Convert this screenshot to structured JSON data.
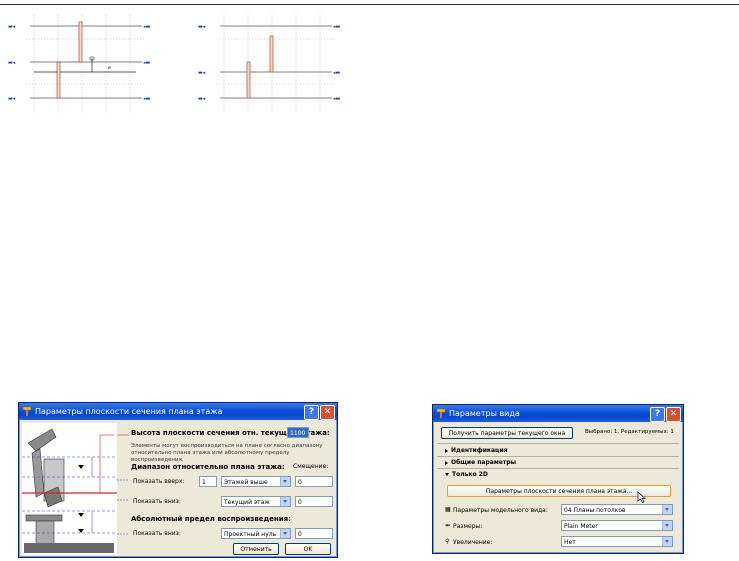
{
  "dialog_section": {
    "title": "Параметры плоскости сечения плана этажа",
    "height_label": "Высота плоскости сечения отн. текущего этажа:",
    "height_value": "1100",
    "description": "Элементы могут воспроизводиться на плане согласно диапазону относительно плана этажа или абсолютному пределу воспроизведения.",
    "range_heading": "Диапазон относительно плана этажа:",
    "offset_heading": "Смещение:",
    "show_up_label": "Показать вверх:",
    "show_up_count": "1",
    "show_up_select": "Этажей выше",
    "show_up_offset": "0",
    "show_down_label": "Показать вниз:",
    "show_down_select": "Текущий этаж",
    "show_down_offset": "0",
    "absolute_heading": "Абсолютный предел воспроизведения:",
    "abs_down_label": "Показать вниз:",
    "abs_down_select": "Проектный нуль",
    "abs_down_offset": "0",
    "cancel_label": "Отменить",
    "ok_label": "OK"
  },
  "dialog_view": {
    "title": "Параметры вида",
    "get_params_button": "Получить параметры текущего окна",
    "selected_info": "Выбрано: 1, Редактируемых: 1",
    "section_ident": "Идентификация",
    "section_general": "Общие параметры",
    "section_2d": "Только 2D",
    "cut_plane_button": "Параметры плоскости сечения плана этажа...",
    "model_view_label": "Параметры модельного вида:",
    "model_view_value": "04 Планы потолков",
    "dimensions_label": "Размеры:",
    "dimensions_value": "Plain Meter",
    "zoom_label": "Увеличение:",
    "zoom_value": "Нет"
  },
  "colors": {
    "title_blue": "#0a4fd8",
    "dialog_bg": "#ece9d8",
    "cut_line_red": "#e02020",
    "range_blue": "#3030e0"
  }
}
